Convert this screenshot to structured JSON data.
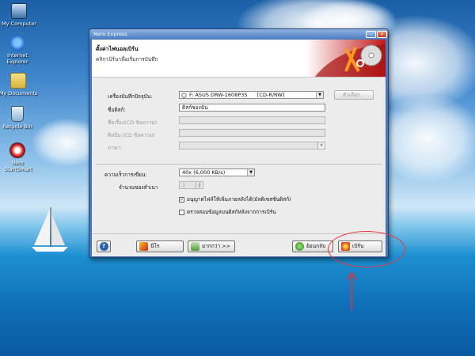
{
  "desktop": {
    "icons": [
      {
        "label": "My Computer",
        "icon": "computer-icon"
      },
      {
        "label": "Internet Explorer",
        "icon": "ie-icon"
      },
      {
        "label": "My Documents",
        "icon": "folder-icon"
      },
      {
        "label": "Recycle Bin",
        "icon": "recycle-bin-icon"
      },
      {
        "label": "Nero StartSmart",
        "icon": "nero-icon"
      }
    ]
  },
  "window": {
    "title": "Nero Express",
    "header_title": "ตั้งค่าไฟนอลเบิร์น",
    "header_subtitle": "คลิก'เบิร์น'เพื่อเริ่มการบันทึก"
  },
  "form": {
    "recorder_label": "เครื่องบันทึกปัจจุบัน:",
    "recorder_value": "F: ASUS DRW-1608P3S      [CD-R/RW]",
    "options_button": "ตัวเลือก...",
    "disc_name_label": "ชื่อดิสก์:",
    "disc_name_value": "ดิสก์ของฉัน",
    "title_label": "ชื่อเรื่อง(CD ข้อความ)",
    "artist_label": "ศิลปิน (CD ข้อความ)",
    "language_label": "ภาษา:",
    "speed_label": "ความเร็วการเขียน:",
    "speed_value": "40x (6,000 KB/s)",
    "copies_label": "จำนวนของสำเนา",
    "copies_value": "1",
    "allow_files_label": "อนุญาตไฟล์ให้เพิ่มภายหลังได้(มัลติเซสชั่นดิสก์)",
    "allow_files_checked": true,
    "verify_label": "ตรวจสอบข้อมูลบนดิสก์หลังจากการเบิร์น",
    "verify_checked": false
  },
  "buttons": {
    "help": "?",
    "nero": "นีโร",
    "more": "มากกว่า >>",
    "back": "ย้อนกลับ",
    "burn": "เบิร์น"
  },
  "annotation": {
    "color": "#e33333"
  }
}
